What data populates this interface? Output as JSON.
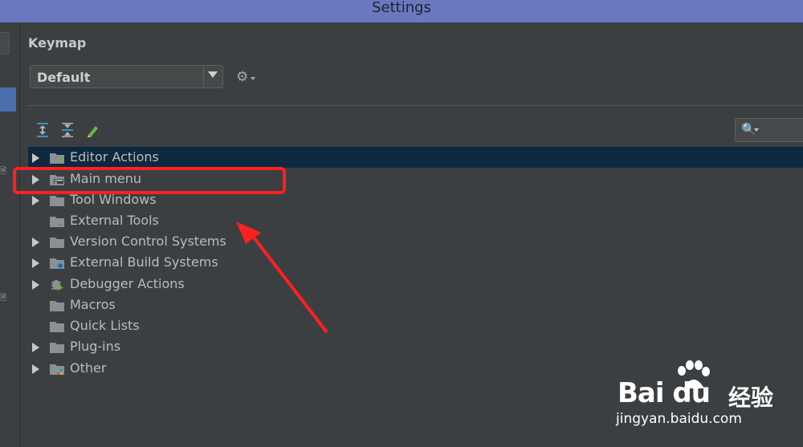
{
  "window": {
    "title": "Settings"
  },
  "keymap": {
    "section_title": "Keymap",
    "scheme_value": "Default",
    "gear_icon": "gear-icon"
  },
  "toolbar": {
    "icons": [
      "expand-all-icon",
      "collapse-all-icon",
      "edit-shortcuts-icon"
    ]
  },
  "search": {
    "icon": "search-icon"
  },
  "tree": {
    "items": [
      {
        "label": "Editor Actions",
        "expandable": true,
        "selected": true,
        "icon": "editor-actions-folder-icon"
      },
      {
        "label": "Main menu",
        "expandable": true,
        "selected": false,
        "icon": "main-menu-folder-icon"
      },
      {
        "label": "Tool Windows",
        "expandable": true,
        "selected": false,
        "icon": "folder-icon"
      },
      {
        "label": "External Tools",
        "expandable": false,
        "selected": false,
        "icon": "external-tools-folder-icon"
      },
      {
        "label": "Version Control Systems",
        "expandable": true,
        "selected": false,
        "icon": "folder-icon"
      },
      {
        "label": "External Build Systems",
        "expandable": true,
        "selected": false,
        "icon": "build-systems-folder-icon"
      },
      {
        "label": "Debugger Actions",
        "expandable": true,
        "selected": false,
        "icon": "debugger-icon"
      },
      {
        "label": "Macros",
        "expandable": false,
        "selected": false,
        "icon": "folder-icon"
      },
      {
        "label": "Quick Lists",
        "expandable": false,
        "selected": false,
        "icon": "folder-icon"
      },
      {
        "label": "Plug-ins",
        "expandable": true,
        "selected": false,
        "icon": "folder-icon"
      },
      {
        "label": "Other",
        "expandable": true,
        "selected": false,
        "icon": "other-folder-icon"
      }
    ]
  },
  "watermark": {
    "brand": "Bai du",
    "brand_cn": "经验",
    "url": "jingyan.baidu.com"
  },
  "colors": {
    "title_bar": "#6a78c0",
    "background": "#3c3f41",
    "selected_row": "#0d293e",
    "annotation": "#ff2020"
  }
}
